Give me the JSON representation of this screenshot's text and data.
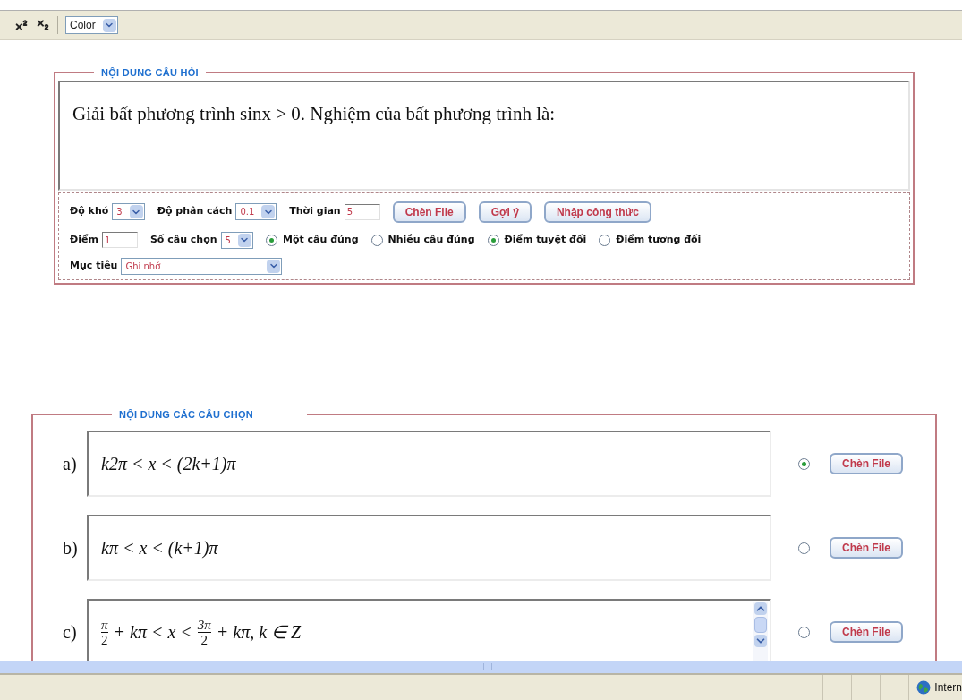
{
  "toolbar": {
    "buttons": [
      {
        "kind": "superscript"
      },
      {
        "kind": "subscript"
      }
    ],
    "color_select": {
      "value": "Color"
    }
  },
  "question": {
    "legend": "NỘI DUNG CÂU HỎI",
    "text": "Giải bất phương trình sinx > 0. Nghiệm của bất phương trình là:",
    "rows": [
      [
        {
          "kind": "select",
          "label": "Độ khó",
          "value": "3"
        },
        {
          "kind": "select",
          "label": "Độ phân cách",
          "value": "0.1"
        },
        {
          "kind": "input",
          "label": "Thời gian",
          "value": "5"
        },
        {
          "kind": "button",
          "label": "Chèn File"
        },
        {
          "kind": "button",
          "label": "Gợi ý"
        },
        {
          "kind": "button",
          "label": "Nhập công thức"
        }
      ],
      [
        {
          "kind": "input",
          "label": "Điểm",
          "value": "1"
        },
        {
          "kind": "select",
          "label": "Số câu chọn",
          "value": "5"
        },
        {
          "kind": "radio",
          "label": "Một câu đúng",
          "selected": true
        },
        {
          "kind": "radio",
          "label": "Nhiều câu đúng",
          "selected": false
        },
        {
          "kind": "radio",
          "label": "Điểm tuyệt đối",
          "selected": true
        },
        {
          "kind": "radio",
          "label": "Điểm tương đối",
          "selected": false
        }
      ],
      [
        {
          "kind": "wide_select",
          "label": "Mục tiêu",
          "value": "Ghi nhớ"
        }
      ]
    ]
  },
  "answers": {
    "legend": "NỘI DUNG CÁC CÂU CHỌN",
    "items": [
      {
        "label": "a)",
        "formula": [
          {
            "kind": "text",
            "text": "k2π < x < (2k+1)π"
          }
        ],
        "selected": true,
        "button": "Chèn File",
        "scrollbar": false
      },
      {
        "label": "b)",
        "formula": [
          {
            "kind": "text",
            "text": "kπ < x < (k+1)π"
          }
        ],
        "selected": false,
        "button": "Chèn File",
        "scrollbar": false
      },
      {
        "label": "c)",
        "formula": [
          {
            "kind": "frac",
            "num": "π",
            "den": "2"
          },
          {
            "kind": "text",
            "text": "+ kπ < x <"
          },
          {
            "kind": "frac",
            "num": "3π",
            "den": "2"
          },
          {
            "kind": "text",
            "text": "+ kπ, k ∈ Z"
          }
        ],
        "selected": false,
        "button": "Chèn File",
        "scrollbar": true
      }
    ]
  },
  "status_bar": {
    "zone": "Intern"
  }
}
